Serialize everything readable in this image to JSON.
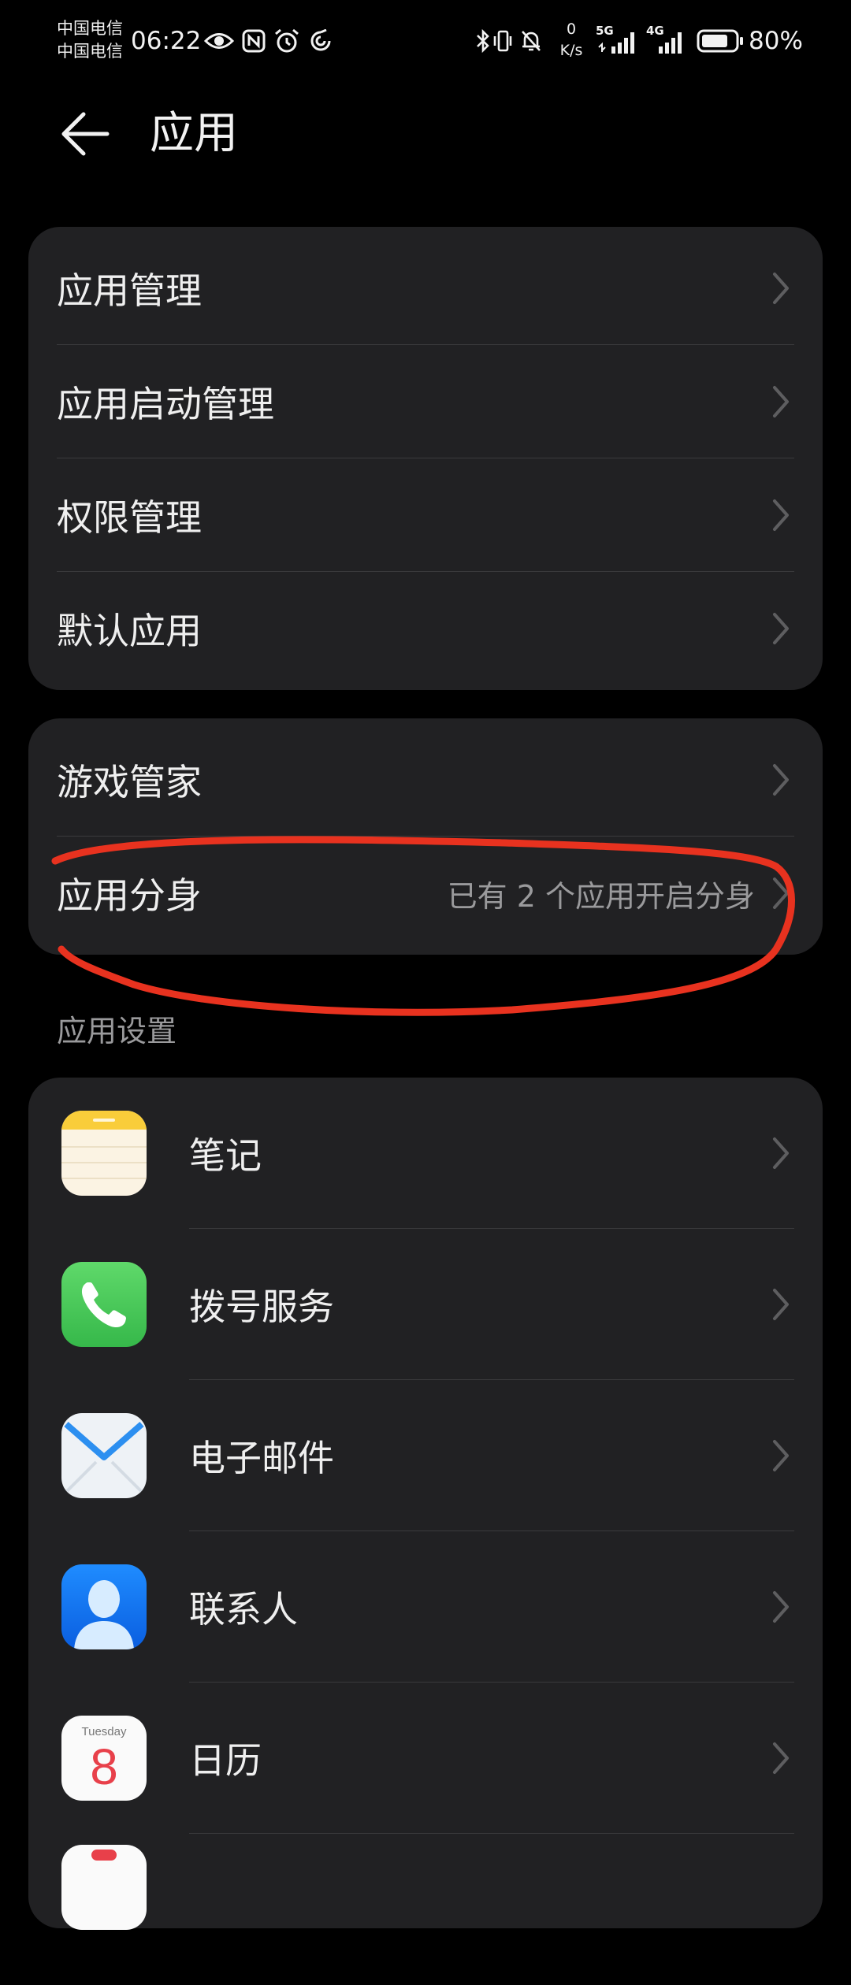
{
  "status_bar": {
    "carrier_1": "中国电信",
    "carrier_2": "中国电信",
    "time": "06:22",
    "net_speed_value": "0",
    "net_speed_unit": "K/s",
    "sim1_network": "5G",
    "sim2_network": "4G",
    "battery_percent": "80%",
    "battery_level": 0.8,
    "icons": [
      "eye-icon",
      "nfc-icon",
      "alarm-icon",
      "swirl-icon",
      "bluetooth-icon",
      "vibrate-icon",
      "mute-bell-icon",
      "signal-icon",
      "battery-icon"
    ]
  },
  "header": {
    "title": "应用",
    "back_icon": "back-arrow-icon"
  },
  "group1": {
    "items": [
      {
        "label": "应用管理"
      },
      {
        "label": "应用启动管理"
      },
      {
        "label": "权限管理"
      },
      {
        "label": "默认应用"
      }
    ]
  },
  "group2": {
    "items": [
      {
        "label": "游戏管家",
        "value": ""
      },
      {
        "label": "应用分身",
        "value": "已有 2 个应用开启分身"
      }
    ]
  },
  "app_settings": {
    "section_title": "应用设置",
    "items": [
      {
        "label": "笔记",
        "icon": "notes-icon"
      },
      {
        "label": "拨号服务",
        "icon": "phone-icon"
      },
      {
        "label": "电子邮件",
        "icon": "email-icon"
      },
      {
        "label": "联系人",
        "icon": "contacts-icon"
      },
      {
        "label": "日历",
        "icon": "calendar-icon",
        "icon_weekday": "Tuesday",
        "icon_day": "8"
      }
    ]
  },
  "colors": {
    "background": "#000000",
    "card": "#212123",
    "annotation": "#e8321f"
  }
}
